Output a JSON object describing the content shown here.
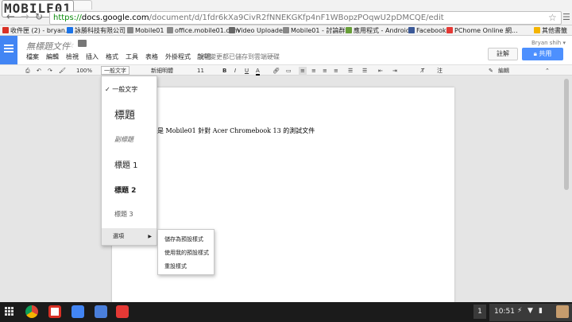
{
  "browser": {
    "watermark": "MOBILE01",
    "url_scheme": "https://",
    "url_host": "docs.google.com",
    "url_path": "/document/d/1fdr6kXa9CivR2fNNEKGKfp4nF1WBopzPOqwU2pDMCQE/edit",
    "bookmarks": [
      {
        "label": "收件匣 (2) - bryan...",
        "color": "#d93025"
      },
      {
        "label": "詠勝科技有限公司",
        "color": "#1a73e8"
      },
      {
        "label": "Mobile01",
        "color": "#888888"
      },
      {
        "label": "office.mobile01.com",
        "color": "#888888"
      },
      {
        "label": "Video Uploader",
        "color": "#666666"
      },
      {
        "label": "Mobile01 - 討論群組",
        "color": "#888888"
      },
      {
        "label": "應用程式 - Android",
        "color": "#689f38"
      },
      {
        "label": "Facebook",
        "color": "#3b5998"
      },
      {
        "label": "PChome Online 網...",
        "color": "#e53935"
      },
      {
        "label": "其他書籤",
        "color": "#f4b400"
      }
    ]
  },
  "docs": {
    "title": "無標題文件",
    "menus": [
      "檔案",
      "編輯",
      "檢視",
      "插入",
      "格式",
      "工具",
      "表格",
      "外掛程式",
      "說明"
    ],
    "save_status": "所有變更都已儲存到雲端硬碟",
    "user": "Bryan shih ▾",
    "comment_label": "註解",
    "share_label": "共用",
    "toolbar": {
      "zoom": "100%",
      "style": "一般文字",
      "font": "新細明體",
      "size": "11",
      "bold": "B",
      "italic": "I",
      "underline": "U",
      "color": "A",
      "line_spacing": "注",
      "edit_mode": "編輯"
    },
    "body_text": "是 Mobile01 針對 Acer Chromebook 13 的測試文件"
  },
  "style_menu": {
    "items": [
      "一般文字",
      "標題",
      "副標題",
      "標題 1",
      "標題 2",
      "標題 3"
    ],
    "checked": "一般文字",
    "options_label": "選項",
    "submenu": [
      "儲存為預設樣式",
      "使用我的預設樣式",
      "重設樣式"
    ]
  },
  "shelf": {
    "notification_count": "1",
    "time": "10:51"
  }
}
